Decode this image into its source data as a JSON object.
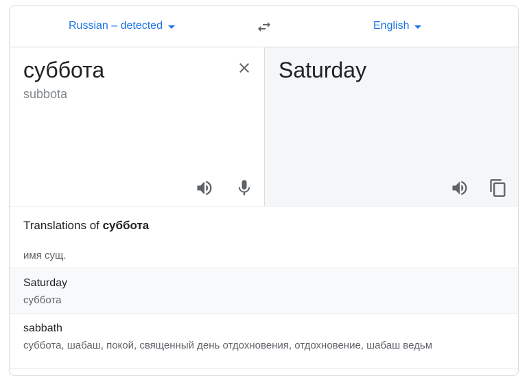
{
  "languages": {
    "source": "Russian – detected",
    "target": "English"
  },
  "source": {
    "text": "суббота",
    "transliteration": "subbota"
  },
  "target": {
    "text": "Saturday"
  },
  "translations": {
    "heading_prefix": "Translations of ",
    "heading_word": "суббота",
    "part_of_speech": "имя сущ.",
    "entries": [
      {
        "word": "Saturday",
        "synonyms": "суббота"
      },
      {
        "word": "sabbath",
        "synonyms": "суббота, шабаш, покой, священный день отдохновения, отдохновение, шабаш ведьм"
      }
    ]
  },
  "colors": {
    "accent": "#1a73e8",
    "icon": "#5f6368",
    "target_pane_bg": "#f5f6f8"
  }
}
